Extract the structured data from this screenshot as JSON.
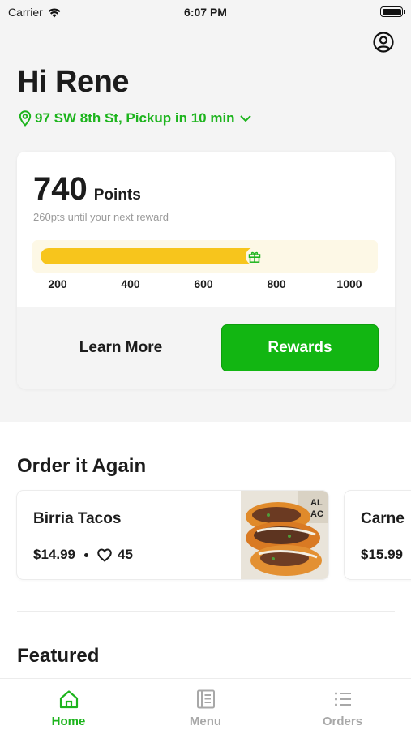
{
  "status_bar": {
    "carrier": "Carrier",
    "time": "6:07 PM",
    "wifi_icon": "wifi-icon",
    "battery_icon": "battery-icon"
  },
  "header": {
    "greeting": "Hi Rene",
    "location": "97 SW 8th St, Pickup in 10 min",
    "profile_icon": "user-circle-icon"
  },
  "points_card": {
    "points": "740",
    "points_unit": "Points",
    "subtitle": "260pts until your next reward",
    "progress_value": 740,
    "progress_max": 1000,
    "scale": [
      "200",
      "400",
      "600",
      "800",
      "1000"
    ],
    "learn_more_label": "Learn More",
    "rewards_label": "Rewards"
  },
  "order_again": {
    "title": "Order it Again",
    "items": [
      {
        "name": "Birria Tacos",
        "price": "$14.99",
        "likes": "45"
      },
      {
        "name": "Carne",
        "price": "$15.99"
      }
    ]
  },
  "featured": {
    "title": "Featured"
  },
  "tabs": [
    {
      "label": "Home",
      "icon": "home-icon",
      "active": true
    },
    {
      "label": "Menu",
      "icon": "menu-book-icon",
      "active": false
    },
    {
      "label": "Orders",
      "icon": "list-icon",
      "active": false
    }
  ],
  "colors": {
    "accent": "#1db41d",
    "button": "#12b612",
    "progress": "#f7c51c",
    "progress_track": "#fdf8e6"
  }
}
